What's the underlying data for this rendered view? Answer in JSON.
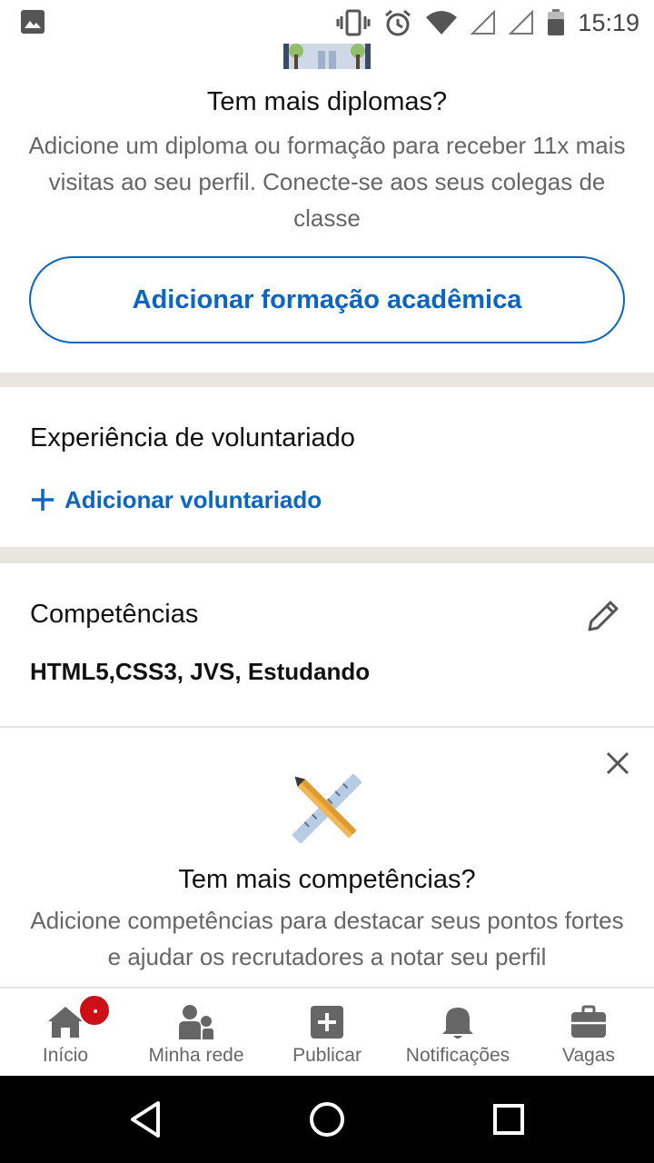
{
  "status_bar": {
    "time": "15:19",
    "icons": [
      "image-icon",
      "vibrate-icon",
      "alarm-icon",
      "wifi-icon",
      "signal-icon",
      "signal-icon",
      "battery-icon"
    ]
  },
  "education_upsell": {
    "title": "Tem mais diplomas?",
    "description": "Adicione um diploma ou formação para receber 11x mais visitas ao seu perfil. Conecte-se aos seus colegas de classe",
    "button_label": "Adicionar formação acadêmica"
  },
  "volunteer": {
    "title": "Experiência de voluntariado",
    "add_label": "Adicionar voluntariado"
  },
  "skills": {
    "title": "Competências",
    "value": "HTML5,CSS3, JVS, Estudando"
  },
  "skills_upsell": {
    "title": "Tem mais competências?",
    "description": "Adicione competências para destacar seus pontos fortes e ajudar os recrutadores a notar seu perfil"
  },
  "bottom_nav": {
    "items": [
      {
        "label": "Início",
        "icon": "home-icon",
        "badge": true
      },
      {
        "label": "Minha rede",
        "icon": "people-icon"
      },
      {
        "label": "Publicar",
        "icon": "plus-box-icon"
      },
      {
        "label": "Notificações",
        "icon": "bell-icon"
      },
      {
        "label": "Vagas",
        "icon": "briefcase-icon"
      }
    ]
  },
  "colors": {
    "accent": "#0a66c2",
    "divider": "#e9e5df",
    "badge": "#cc1016",
    "muted_text": "#666666"
  }
}
